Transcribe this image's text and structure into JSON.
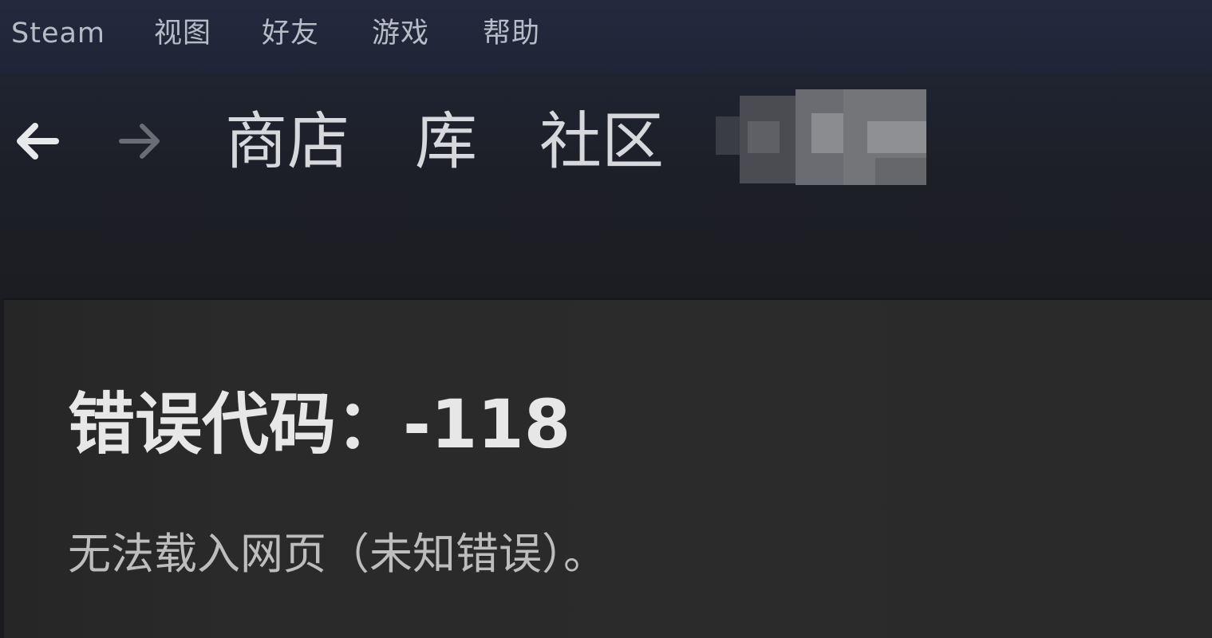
{
  "menubar": {
    "items": [
      {
        "label": "Steam"
      },
      {
        "label": "视图"
      },
      {
        "label": "好友"
      },
      {
        "label": "游戏"
      },
      {
        "label": "帮助"
      }
    ]
  },
  "nav": {
    "back_icon": "arrow-left-icon",
    "forward_icon": "arrow-right-icon",
    "tabs": [
      {
        "label": "商店"
      },
      {
        "label": "库"
      },
      {
        "label": "社区"
      }
    ],
    "username_redacted": true
  },
  "error": {
    "title": "错误代码：-118",
    "message": "无法载入网页（未知错误）。"
  },
  "colors": {
    "menubar_bg": "#232a3e",
    "content_bg": "#2a2a2a",
    "title_text": "#e7e7e7",
    "message_text": "#bdbdbd"
  }
}
